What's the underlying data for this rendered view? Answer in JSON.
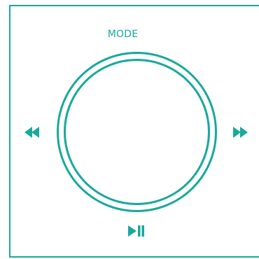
{
  "player": {
    "mode_label": "MODE",
    "controls": {
      "rewind_icon": "rewind-icon",
      "fast_forward_icon": "fast-forward-icon",
      "play_pause_icon": "play-pause-icon"
    }
  },
  "colors": {
    "accent": "#18a99a",
    "background": "#ffffff"
  }
}
